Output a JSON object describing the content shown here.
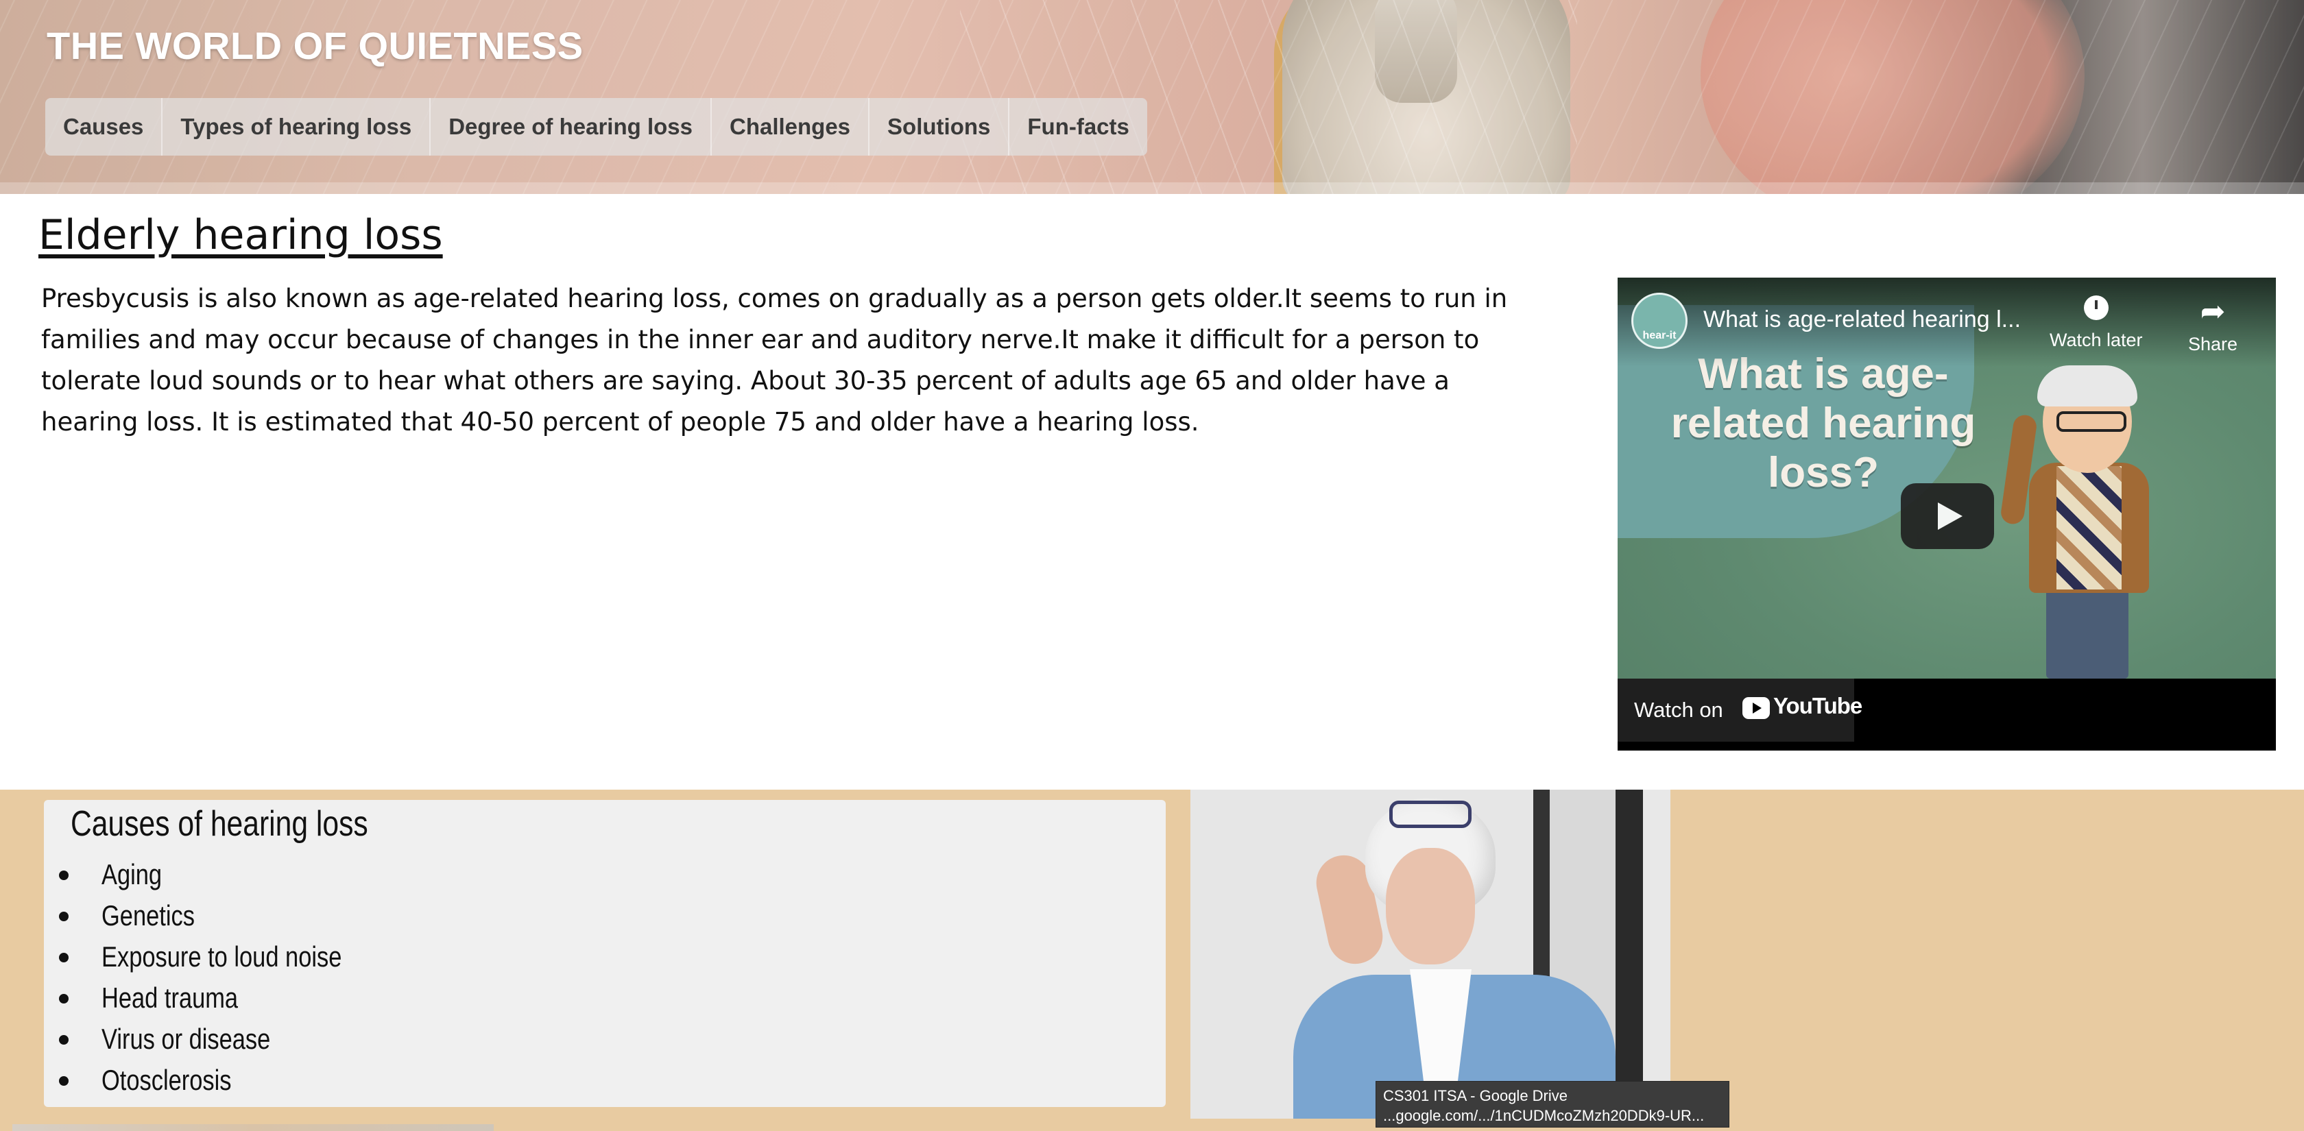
{
  "site": {
    "title": "THE WORLD OF QUIETNESS"
  },
  "nav": {
    "items": [
      {
        "label": "Causes"
      },
      {
        "label": "Types of hearing loss"
      },
      {
        "label": "Degree of hearing loss"
      },
      {
        "label": "Challenges"
      },
      {
        "label": "Solutions"
      },
      {
        "label": "Fun-facts"
      }
    ]
  },
  "main": {
    "heading": "Elderly hearing loss",
    "body": "Presbycusis is also known as age-related hearing loss, comes on gradually as a person gets older.It seems to run in families and may occur because of changes in the inner ear and auditory nerve.It make it difficult for a person to tolerate loud sounds or to hear what others are saying. About 30-35 percent of adults age 65 and older have a hearing loss. It is estimated that 40-50 percent of people 75 and older have a hearing loss."
  },
  "video": {
    "channel_logo_text": "hear-it",
    "title": "What is age-related hearing l...",
    "watch_later_label": "Watch later",
    "share_label": "Share",
    "thumbnail_headline": "What is age-related hearing loss?",
    "watch_on_label": "Watch on",
    "youtube_label": "YouTube"
  },
  "causes": {
    "heading": "Causes of hearing loss",
    "items": [
      "Aging",
      "Genetics",
      "Exposure to loud noise",
      "Head trauma",
      "Virus or disease",
      "Otosclerosis"
    ]
  },
  "tooltip": {
    "line1": "CS301 ITSA - Google Drive",
    "line2": "...google.com/.../1nCUDMcoZMzh20DDk9-UR..."
  },
  "colors": {
    "causes_band": "#e8cba1",
    "causes_box": "#f0f0f0",
    "nav_bg": "rgba(225,225,225,0.72)"
  }
}
